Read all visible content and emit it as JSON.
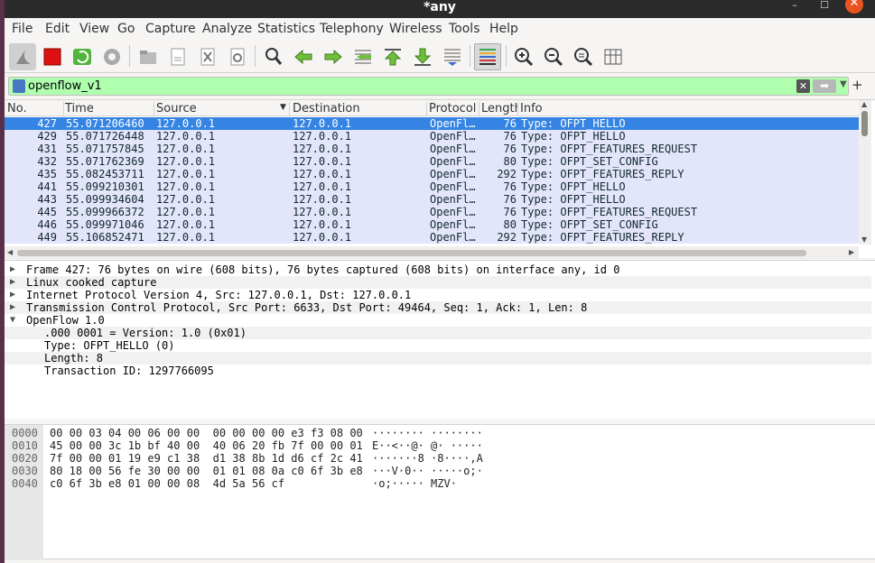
{
  "window": {
    "title": "*any",
    "minimize": "–",
    "maximize": "☐",
    "close": "✕"
  },
  "menu": [
    "File",
    "Edit",
    "View",
    "Go",
    "Capture",
    "Analyze",
    "Statistics",
    "Telephony",
    "Wireless",
    "Tools",
    "Help"
  ],
  "toolbar_icons": [
    "shark-fin-start-icon",
    "stop-capture-icon",
    "restart-capture-icon",
    "capture-options-icon",
    "open-file-icon",
    "save-file-icon",
    "close-file-icon",
    "reload-file-icon",
    "find-packet-icon",
    "go-back-icon",
    "go-forward-icon",
    "go-to-packet-icon",
    "first-packet-icon",
    "last-packet-icon",
    "autoscroll-icon",
    "colorize-icon",
    "zoom-in-icon",
    "zoom-out-icon",
    "normal-size-icon",
    "resize-columns-icon"
  ],
  "filter": {
    "value": "openflow_v1"
  },
  "columns": [
    "No.",
    "Time",
    "Source",
    "Destination",
    "Protocol",
    "Length",
    "Info"
  ],
  "packets": [
    {
      "no": "427",
      "time": "55.071206460",
      "src": "127.0.0.1",
      "dst": "127.0.0.1",
      "proto": "OpenFl…",
      "len": "76",
      "info": "Type: OFPT_HELLO",
      "selected": true
    },
    {
      "no": "429",
      "time": "55.071726448",
      "src": "127.0.0.1",
      "dst": "127.0.0.1",
      "proto": "OpenFl…",
      "len": "76",
      "info": "Type: OFPT_HELLO"
    },
    {
      "no": "431",
      "time": "55.071757845",
      "src": "127.0.0.1",
      "dst": "127.0.0.1",
      "proto": "OpenFl…",
      "len": "76",
      "info": "Type: OFPT_FEATURES_REQUEST"
    },
    {
      "no": "432",
      "time": "55.071762369",
      "src": "127.0.0.1",
      "dst": "127.0.0.1",
      "proto": "OpenFl…",
      "len": "80",
      "info": "Type: OFPT_SET_CONFIG"
    },
    {
      "no": "435",
      "time": "55.082453711",
      "src": "127.0.0.1",
      "dst": "127.0.0.1",
      "proto": "OpenFl…",
      "len": "292",
      "info": "Type: OFPT_FEATURES_REPLY"
    },
    {
      "no": "441",
      "time": "55.099210301",
      "src": "127.0.0.1",
      "dst": "127.0.0.1",
      "proto": "OpenFl…",
      "len": "76",
      "info": "Type: OFPT_HELLO"
    },
    {
      "no": "443",
      "time": "55.099934604",
      "src": "127.0.0.1",
      "dst": "127.0.0.1",
      "proto": "OpenFl…",
      "len": "76",
      "info": "Type: OFPT_HELLO"
    },
    {
      "no": "445",
      "time": "55.099966372",
      "src": "127.0.0.1",
      "dst": "127.0.0.1",
      "proto": "OpenFl…",
      "len": "76",
      "info": "Type: OFPT_FEATURES_REQUEST"
    },
    {
      "no": "446",
      "time": "55.099971046",
      "src": "127.0.0.1",
      "dst": "127.0.0.1",
      "proto": "OpenFl…",
      "len": "80",
      "info": "Type: OFPT_SET_CONFIG"
    },
    {
      "no": "449",
      "time": "55.106852471",
      "src": "127.0.0.1",
      "dst": "127.0.0.1",
      "proto": "OpenFl…",
      "len": "292",
      "info": "Type: OFPT_FEATURES_REPLY"
    }
  ],
  "details": [
    {
      "text": "Frame 427: 76 bytes on wire (608 bits), 76 bytes captured (608 bits) on interface any, id 0",
      "arrow": "right"
    },
    {
      "text": "Linux cooked capture",
      "arrow": "right"
    },
    {
      "text": "Internet Protocol Version 4, Src: 127.0.0.1, Dst: 127.0.0.1",
      "arrow": "right"
    },
    {
      "text": "Transmission Control Protocol, Src Port: 6633, Dst Port: 49464, Seq: 1, Ack: 1, Len: 8",
      "arrow": "right"
    },
    {
      "text": "OpenFlow 1.0",
      "arrow": "down"
    },
    {
      "text": ".000 0001 = Version: 1.0 (0x01)",
      "indent": true
    },
    {
      "text": "Type: OFPT_HELLO (0)",
      "indent": true
    },
    {
      "text": "Length: 8",
      "indent": true
    },
    {
      "text": "Transaction ID: 1297766095",
      "indent": true
    }
  ],
  "hex": [
    {
      "off": "0000",
      "hex": "00 00 03 04 00 06 00 00  00 00 00 00 e3 f3 08 00",
      "asc": "········ ········"
    },
    {
      "off": "0010",
      "hex": "45 00 00 3c 1b bf 40 00  40 06 20 fb 7f 00 00 01",
      "asc": "E··<··@· @· ·····"
    },
    {
      "off": "0020",
      "hex": "7f 00 00 01 19 e9 c1 38  d1 38 8b 1d d6 cf 2c 41",
      "asc": "·······8 ·8····,A"
    },
    {
      "off": "0030",
      "hex": "80 18 00 56 fe 30 00 00  01 01 08 0a c0 6f 3b e8",
      "asc": "···V·0·· ·····o;·"
    },
    {
      "off": "0040",
      "hex": "c0 6f 3b e8 01 00 00 08  4d 5a 56 cf",
      "asc": "·o;····· MZV·"
    }
  ],
  "colors": {
    "selected": "#3584e4",
    "row": "#e3e6fb",
    "filter_ok": "#afffaf"
  }
}
